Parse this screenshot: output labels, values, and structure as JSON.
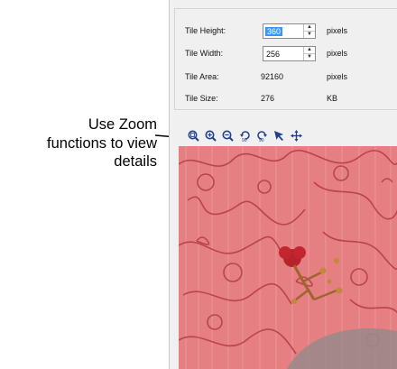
{
  "settings": {
    "rows": [
      {
        "label": "Tile Height:",
        "value": "360",
        "unit": "pixels",
        "editable": true,
        "selected": true
      },
      {
        "label": "Tile Width:",
        "value": "256",
        "unit": "pixels",
        "editable": true,
        "selected": false
      },
      {
        "label": "Tile Area:",
        "value": "92160",
        "unit": "pixels",
        "editable": false
      },
      {
        "label": "Tile Size:",
        "value": "276",
        "unit": "KB",
        "editable": false
      }
    ]
  },
  "toolbar": {
    "tools": [
      {
        "icon": "zoom-fit-icon",
        "name": "zoom-fit-button"
      },
      {
        "icon": "zoom-in-icon",
        "name": "zoom-in-button"
      },
      {
        "icon": "zoom-out-icon",
        "name": "zoom-out-button"
      },
      {
        "icon": "rotate-left-90-icon",
        "name": "rotate-left-button",
        "label": "90"
      },
      {
        "icon": "rotate-right-90-icon",
        "name": "rotate-right-button",
        "label": "90"
      },
      {
        "icon": "select-arrow-icon",
        "name": "select-tool-button"
      },
      {
        "icon": "move-icon",
        "name": "pan-tool-button"
      }
    ]
  },
  "callout": {
    "lines": [
      "Use Zoom",
      "functions to view",
      "details"
    ]
  },
  "colors": {
    "accent": "#1f3f8f",
    "selection": "#3399ff",
    "fabric": "#e57f82"
  }
}
